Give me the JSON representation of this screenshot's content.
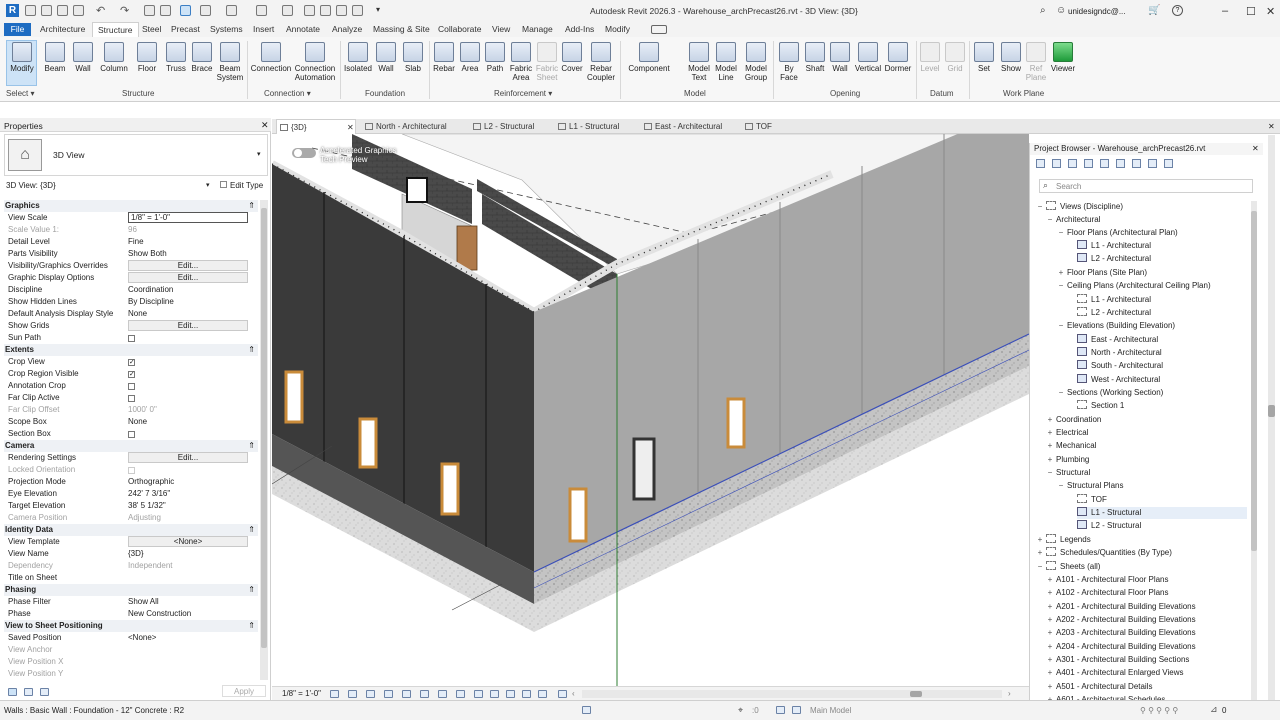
{
  "app": {
    "title": "Autodesk Revit 2026.3 - Warehouse_archPrecast26.rvt - 3D View: {3D}",
    "user": "unidesigndc@...",
    "accent": "#1e6cc2"
  },
  "menu": {
    "tabs": [
      "File",
      "Architecture",
      "Structure",
      "Steel",
      "Precast",
      "Systems",
      "Insert",
      "Annotate",
      "Analyze",
      "Massing & Site",
      "Collaborate",
      "View",
      "Manage",
      "Add-Ins",
      "Modify"
    ],
    "active": "Structure"
  },
  "ribbon": {
    "buttons": [
      "Modify",
      "Beam",
      "Wall",
      "Column",
      "Floor",
      "Truss",
      "Brace",
      "Beam\nSystem",
      "Connection",
      "Connection\nAutomation",
      "Isolated",
      "Wall",
      "Slab",
      "Rebar",
      "Area",
      "Path",
      "Fabric\nArea",
      "Fabric\nSheet",
      "Cover",
      "Rebar\nCoupler",
      "Component",
      "Model\nText",
      "Model\nLine",
      "Model\nGroup",
      "By\nFace",
      "Shaft",
      "Wall",
      "Vertical",
      "Dormer",
      "Level",
      "Grid",
      "Set",
      "Show",
      "Ref\nPlane",
      "Viewer"
    ],
    "groups": [
      "Select",
      "Structure",
      "Connection",
      "Foundation",
      "Reinforcement",
      "Model",
      "Opening",
      "Datum",
      "Work Plane"
    ]
  },
  "properties": {
    "title": "Properties",
    "type_name": "3D View",
    "selector": "3D View: {3D}",
    "edit_type": "Edit Type",
    "apply": "Apply",
    "categories": {
      "graphics": "Graphics",
      "extents": "Extents",
      "camera": "Camera",
      "identity": "Identity Data",
      "phasing": "Phasing",
      "sheet": "View to Sheet Positioning"
    },
    "rows": {
      "view_scale": [
        "View Scale",
        "1/8\" = 1'-0\""
      ],
      "scale_value": [
        "Scale Value    1:",
        "96"
      ],
      "detail_level": [
        "Detail Level",
        "Fine"
      ],
      "parts_visibility": [
        "Parts Visibility",
        "Show Both"
      ],
      "vg_overrides": [
        "Visibility/Graphics Overrides",
        "Edit..."
      ],
      "graphic_display": [
        "Graphic Display Options",
        "Edit..."
      ],
      "discipline": [
        "Discipline",
        "Coordination"
      ],
      "hidden_lines": [
        "Show Hidden Lines",
        "By Discipline"
      ],
      "analysis_style": [
        "Default Analysis Display Style",
        "None"
      ],
      "show_grids": [
        "Show Grids",
        "Edit..."
      ],
      "sun_path": [
        "Sun Path",
        ""
      ],
      "crop_view": [
        "Crop View",
        ""
      ],
      "crop_region": [
        "Crop Region Visible",
        ""
      ],
      "annotation_crop": [
        "Annotation Crop",
        ""
      ],
      "far_clip": [
        "Far Clip Active",
        ""
      ],
      "far_clip_offset": [
        "Far Clip Offset",
        "1000'  0\""
      ],
      "scope_box": [
        "Scope Box",
        "None"
      ],
      "section_box": [
        "Section Box",
        ""
      ],
      "rendering": [
        "Rendering Settings",
        "Edit..."
      ],
      "locked_orientation": [
        "Locked Orientation",
        ""
      ],
      "projection": [
        "Projection Mode",
        "Orthographic"
      ],
      "eye_elevation": [
        "Eye Elevation",
        "242'  7 3/16\""
      ],
      "target_elevation": [
        "Target Elevation",
        "38'  5 1/32\""
      ],
      "camera_position": [
        "Camera Position",
        "Adjusting"
      ],
      "view_template": [
        "View Template",
        "<None>"
      ],
      "view_name": [
        "View Name",
        "{3D}"
      ],
      "dependency": [
        "Dependency",
        "Independent"
      ],
      "title_on_sheet": [
        "Title on Sheet",
        ""
      ],
      "phase_filter": [
        "Phase Filter",
        "Show All"
      ],
      "phase": [
        "Phase",
        "New Construction"
      ],
      "saved_position": [
        "Saved Position",
        "<None>"
      ],
      "view_anchor": [
        "View Anchor",
        ""
      ],
      "view_pos_x": [
        "View Position X",
        ""
      ],
      "view_pos_y": [
        "View Position Y",
        ""
      ]
    }
  },
  "view_tabs": [
    "{3D}",
    "North - Architectural",
    "L2 - Structural",
    "L1 - Structural",
    "East - Architectural",
    "TOF"
  ],
  "canvas": {
    "overlay": "Accelerated Graphics\nTech Preview"
  },
  "browser": {
    "title": "Project Browser - Warehouse_archPrecast26.rvt",
    "search_placeholder": "Search",
    "tree": [
      "Views (Discipline)",
      "Architectural",
      "Floor Plans (Architectural Plan)",
      "L1 - Architectural",
      "L2 - Architectural",
      "Floor Plans (Site Plan)",
      "Ceiling Plans (Architectural Ceiling Plan)",
      "L1 - Architectural",
      "L2 - Architectural",
      "Elevations (Building Elevation)",
      "East - Architectural",
      "North - Architectural",
      "South - Architectural",
      "West - Architectural",
      "Sections (Working Section)",
      "Section 1",
      "Coordination",
      "Electrical",
      "Mechanical",
      "Plumbing",
      "Structural",
      "Structural Plans",
      "TOF",
      "L1 - Structural",
      "L2 - Structural",
      "Legends",
      "Schedules/Quantities (By Type)",
      "Sheets (all)",
      "A101 - Architectural Floor Plans",
      "A102 - Architectural Floor Plans",
      "A201 - Architectural Building Elevations",
      "A202 - Architectural Building Elevations",
      "A203 - Architectural Building Elevations",
      "A204 - Architectural Building Elevations",
      "A301 - Architectural Building Sections",
      "A401 - Architectural Enlarged Views",
      "A501 - Architectural Details",
      "A601 - Architectural Schedules"
    ]
  },
  "view_control": {
    "scale": "1/8\" = 1'-0\""
  },
  "status": {
    "selection": "Walls : Basic Wall : Foundation - 12\" Concrete : R2",
    "zero": ":0",
    "model": "Main Model",
    "filter": "0"
  }
}
